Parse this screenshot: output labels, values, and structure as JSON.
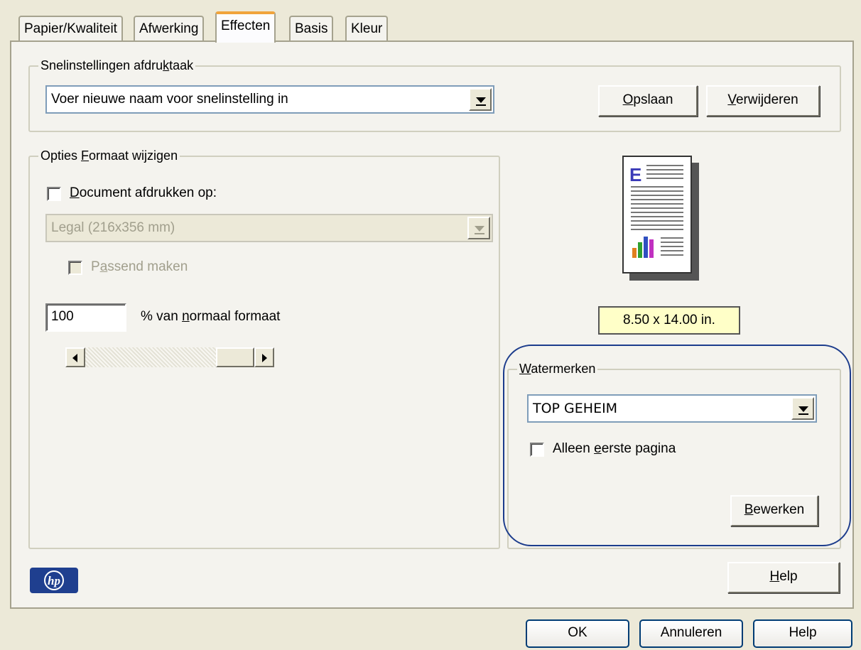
{
  "tabs": [
    {
      "label": "Papier/Kwaliteit",
      "active": false
    },
    {
      "label": "Afwerking",
      "active": false
    },
    {
      "label": "Effecten",
      "active": true
    },
    {
      "label": "Basis",
      "active": false
    },
    {
      "label": "Kleur",
      "active": false
    }
  ],
  "quick_settings": {
    "legend_pre": "Snelinstellingen afdru",
    "legend_key": "k",
    "legend_post": "taak",
    "combo_value": "Voer nieuwe naam voor snelinstelling in",
    "save_key": "O",
    "save_rest": "pslaan",
    "delete_key": "V",
    "delete_rest": "erwijderen"
  },
  "resize": {
    "legend_pre": "Opties ",
    "legend_key": "F",
    "legend_post": "ormaat wijzigen",
    "print_on_key": "D",
    "print_on_rest": "ocument afdrukken op:",
    "print_on_checked": false,
    "paper_value": "Legal (216x356 mm)",
    "fit_pre": "P",
    "fit_key": "a",
    "fit_post": "ssend maken",
    "percent_value": "100",
    "percent_pre": "% van ",
    "percent_key": "n",
    "percent_post": "ormaal formaat"
  },
  "preview": {
    "size_text": "8.50 x 14.00 in."
  },
  "watermarks": {
    "legend_key": "W",
    "legend_rest": "atermerken",
    "combo_value": "TOP GEHEIM",
    "first_page_pre": "Alleen ",
    "first_page_key": "e",
    "first_page_post": "erste pagina",
    "first_page_checked": false,
    "edit_key": "B",
    "edit_rest": "ewerken"
  },
  "help_inner_key": "H",
  "help_inner_rest": "elp",
  "footer": {
    "ok": "OK",
    "cancel": "Annuleren",
    "help": "Help"
  },
  "colors": {
    "dialog_bg": "#ece9d8",
    "active_tab_accent": "#f0a43c",
    "size_label_bg": "#ffffc8",
    "highlight_ring": "#1c3c8c",
    "hp_logo_blue": "#1f3f8f"
  },
  "icons": {
    "hp_logo": "hp-logo-icon",
    "page_preview": "document-preview-icon"
  }
}
